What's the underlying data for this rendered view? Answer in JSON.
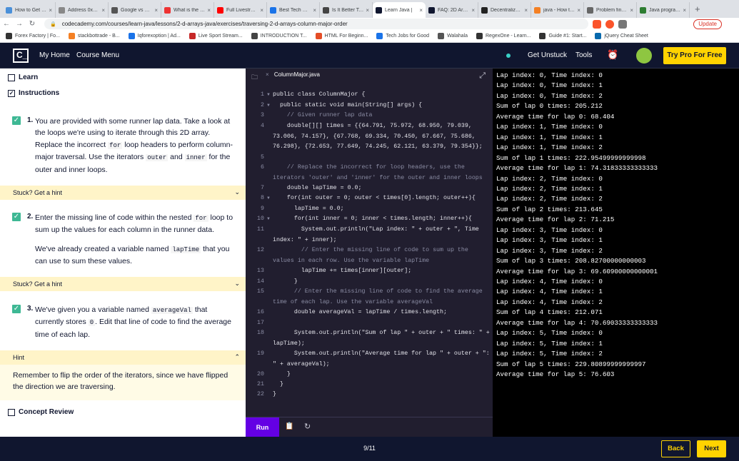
{
  "browser": {
    "tabs": [
      {
        "title": "How to Get a Sof",
        "color": "#4a90d9"
      },
      {
        "title": "Address 0x073c",
        "color": "#888"
      },
      {
        "title": "Google vs Faceb",
        "color": "#555"
      },
      {
        "title": "What is the Prim",
        "color": "#e33"
      },
      {
        "title": "Full Livestream",
        "color": "#f00"
      },
      {
        "title": "Best Tech Comp",
        "color": "#1a73e8"
      },
      {
        "title": "Is It Better To In",
        "color": "#444"
      },
      {
        "title": "Learn Java |",
        "color": "#10162f"
      },
      {
        "title": "FAQ: 2D Arrays",
        "color": "#10162f"
      },
      {
        "title": "Decentralized M",
        "color": "#222"
      },
      {
        "title": "java - How to D",
        "color": "#f48024"
      },
      {
        "title": "Problem finding",
        "color": "#666"
      },
      {
        "title": "Java program to",
        "color": "#2e7d32"
      }
    ],
    "url": "codecademy.com/courses/learn-java/lessons/2-d-arrays-java/exercises/traversing-2-d-arrays-column-major-order",
    "update_label": "Update",
    "bookmarks": [
      {
        "label": "Forex Factory | Fo...",
        "color": "#333"
      },
      {
        "label": "stackbottrade - B...",
        "color": "#f48024"
      },
      {
        "label": "Iqforexoption | Ad...",
        "color": "#1a73e8"
      },
      {
        "label": "Live Sport Stream...",
        "color": "#c62828"
      },
      {
        "label": "INTRODUCTION T...",
        "color": "#444"
      },
      {
        "label": "HTML For Beginn...",
        "color": "#e44d26"
      },
      {
        "label": "Tech Jobs for Good",
        "color": "#1a73e8"
      },
      {
        "label": "Walahala",
        "color": "#555"
      },
      {
        "label": "RegexOne - Learn...",
        "color": "#333"
      },
      {
        "label": "Guide #1: Start...",
        "color": "#333"
      },
      {
        "label": "jQuery Cheat Sheet",
        "color": "#0769ad"
      }
    ]
  },
  "header": {
    "logo": "C_",
    "my_home": "My Home",
    "course_menu": "Course Menu",
    "get_unstuck": "Get Unstuck",
    "tools": "Tools",
    "try_pro": "Try Pro For Free"
  },
  "left": {
    "learn": "Learn",
    "instructions": "Instructions",
    "tasks": [
      {
        "num": "1.",
        "parts": [
          "You are provided with some runner lap data. Take a look at the loops we're using to iterate through this 2D array. Replace the incorrect ",
          "for",
          " loop headers to perform column-major traversal. Use the iterators ",
          "outer",
          " and ",
          "inner",
          " for the outer and inner loops."
        ]
      },
      {
        "num": "2.",
        "parts": [
          "Enter the missing line of code within the nested ",
          "for",
          " loop to sum up the values for each column in the runner data."
        ],
        "p2": [
          "We've already created a variable named ",
          "lapTime",
          " that you can use to sum these values."
        ]
      },
      {
        "num": "3.",
        "parts": [
          "We've given you a variable named ",
          "averageVal",
          " that currently stores ",
          "0",
          ". Edit that line of code to find the average time of each lap."
        ]
      }
    ],
    "stuck_label": "Stuck? Get a hint",
    "hint_label": "Hint",
    "hint_text": "Remember to flip the order of the iterators, since we have flipped the direction we are traversing.",
    "concept_review": "Concept Review"
  },
  "editor": {
    "filename": "ColumnMajor.java",
    "run_label": "Run",
    "lines": [
      {
        "n": "1",
        "fold": true,
        "text": "public class ColumnMajor {"
      },
      {
        "n": "2",
        "fold": true,
        "text": "  public static void main(String[] args) {"
      },
      {
        "n": "3",
        "fold": false,
        "text": "    // Given runner lap data"
      },
      {
        "n": "4",
        "fold": false,
        "text": "    double[][] times = {{64.791, 75.972, 68.950, 79.039, 73.006, 74.157}, {67.768, 69.334, 70.450, 67.667, 75.686, 76.298}, {72.653, 77.649, 74.245, 62.121, 63.379, 79.354}};"
      },
      {
        "n": "5",
        "fold": false,
        "text": ""
      },
      {
        "n": "6",
        "fold": false,
        "text": "    // Replace the incorrect for loop headers, use the iterators 'outer' and 'inner' for the outer and inner loops"
      },
      {
        "n": "7",
        "fold": false,
        "text": "    double lapTime = 0.0;"
      },
      {
        "n": "8",
        "fold": true,
        "text": "    for(int outer = 0; outer < times[0].length; outer++){"
      },
      {
        "n": "9",
        "fold": false,
        "text": "      lapTime = 0.0;"
      },
      {
        "n": "10",
        "fold": true,
        "text": "      for(int inner = 0; inner < times.length; inner++){"
      },
      {
        "n": "11",
        "fold": false,
        "text": "        System.out.println(\"Lap index: \" + outer + \", Time index: \" + inner);"
      },
      {
        "n": "12",
        "fold": false,
        "text": "        // Enter the missing line of code to sum up the values in each row. Use the variable lapTime"
      },
      {
        "n": "13",
        "fold": false,
        "text": "        lapTime += times[inner][outer];"
      },
      {
        "n": "14",
        "fold": false,
        "text": "      }"
      },
      {
        "n": "15",
        "fold": false,
        "text": "      // Enter the missing line of code to find the average time of each lap. Use the variable averageVal"
      },
      {
        "n": "16",
        "fold": false,
        "text": "      double averageVal = lapTime / times.length;"
      },
      {
        "n": "17",
        "fold": false,
        "text": ""
      },
      {
        "n": "18",
        "fold": false,
        "text": "      System.out.println(\"Sum of lap \" + outer + \" times: \" + lapTime);"
      },
      {
        "n": "19",
        "fold": false,
        "text": "      System.out.println(\"Average time for lap \" + outer + \": \" + averageVal);"
      },
      {
        "n": "20",
        "fold": false,
        "text": "    }"
      },
      {
        "n": "21",
        "fold": false,
        "text": "  }"
      },
      {
        "n": "22",
        "fold": false,
        "text": "}"
      }
    ]
  },
  "output": [
    "Lap index: 0, Time index: 0",
    "Lap index: 0, Time index: 1",
    "Lap index: 0, Time index: 2",
    "Sum of lap 0 times: 205.212",
    "Average time for lap 0: 68.404",
    "Lap index: 1, Time index: 0",
    "Lap index: 1, Time index: 1",
    "Lap index: 1, Time index: 2",
    "Sum of lap 1 times: 222.95499999999998",
    "Average time for lap 1: 74.31833333333333",
    "Lap index: 2, Time index: 0",
    "Lap index: 2, Time index: 1",
    "Lap index: 2, Time index: 2",
    "Sum of lap 2 times: 213.645",
    "Average time for lap 2: 71.215",
    "Lap index: 3, Time index: 0",
    "Lap index: 3, Time index: 1",
    "Lap index: 3, Time index: 2",
    "Sum of lap 3 times: 208.82700000000003",
    "Average time for lap 3: 69.60900000000001",
    "Lap index: 4, Time index: 0",
    "Lap index: 4, Time index: 1",
    "Lap index: 4, Time index: 2",
    "Sum of lap 4 times: 212.071",
    "Average time for lap 4: 70.69033333333333",
    "Lap index: 5, Time index: 0",
    "Lap index: 5, Time index: 1",
    "Lap index: 5, Time index: 2",
    "Sum of lap 5 times: 229.80899999999997",
    "Average time for lap 5: 76.603"
  ],
  "footer": {
    "progress": "9/11",
    "back": "Back",
    "next": "Next"
  }
}
